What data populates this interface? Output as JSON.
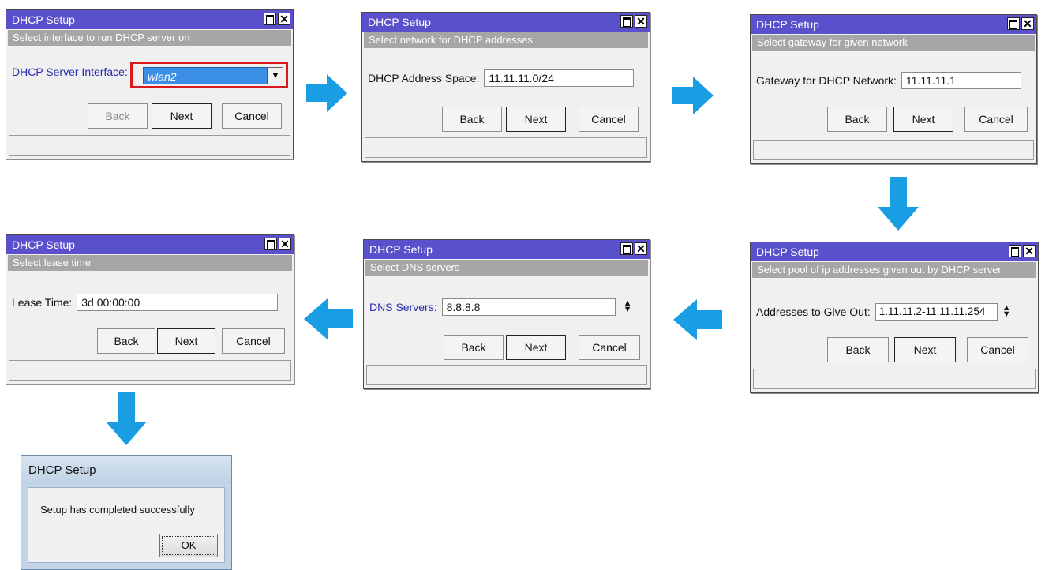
{
  "colors": {
    "titlebar": "#5a50cc",
    "subheader": "#a6a6a6",
    "arrow": "#1a9ee3",
    "highlight": "#d9191c"
  },
  "icons": {
    "maximize": "maximize-icon",
    "close": "close-icon",
    "arrow": "arrow-icon",
    "dropdown": "dropdown-arrow-icon",
    "spinner": "spinner-icon"
  },
  "steps": [
    {
      "title": "DHCP Setup",
      "subheader": "Select interface to run DHCP server on",
      "field_label": "DHCP Server Interface:",
      "field_value": "wlan2",
      "buttons": {
        "back": "Back",
        "next": "Next",
        "cancel": "Cancel"
      }
    },
    {
      "title": "DHCP Setup",
      "subheader": "Select network for DHCP addresses",
      "field_label": "DHCP Address Space:",
      "field_value": "11.11.11.0/24",
      "buttons": {
        "back": "Back",
        "next": "Next",
        "cancel": "Cancel"
      }
    },
    {
      "title": "DHCP Setup",
      "subheader": "Select gateway for given network",
      "field_label": "Gateway for DHCP Network:",
      "field_value": "11.11.11.1",
      "buttons": {
        "back": "Back",
        "next": "Next",
        "cancel": "Cancel"
      }
    },
    {
      "title": "DHCP Setup",
      "subheader": "Select pool of ip addresses given out by DHCP server",
      "field_label": "Addresses to Give Out:",
      "field_value": "1.11.11.2-11.11.11.254",
      "buttons": {
        "back": "Back",
        "next": "Next",
        "cancel": "Cancel"
      }
    },
    {
      "title": "DHCP Setup",
      "subheader": "Select DNS servers",
      "field_label": "DNS Servers:",
      "field_value": "8.8.8.8",
      "buttons": {
        "back": "Back",
        "next": "Next",
        "cancel": "Cancel"
      }
    },
    {
      "title": "DHCP Setup",
      "subheader": "Select lease time",
      "field_label": "Lease Time:",
      "field_value": "3d 00:00:00",
      "buttons": {
        "back": "Back",
        "next": "Next",
        "cancel": "Cancel"
      }
    }
  ],
  "completion": {
    "title": "DHCP Setup",
    "message": "Setup has completed successfully",
    "ok": "OK"
  }
}
